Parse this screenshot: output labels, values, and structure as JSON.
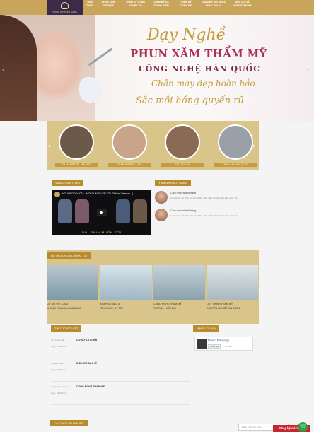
{
  "nav": {
    "logo_text": "THẨM MỸ VIỆN KARA",
    "items": [
      {
        "line1": "GIỚI",
        "line2": "THIỆU"
      },
      {
        "line1": "PHUN XĂM",
        "line2": "THẨM MỸ"
      },
      {
        "line1": "THẨM MỸ CÔNG",
        "line2": "NGHỆ CAO"
      },
      {
        "line1": "THẨM MỸ DA",
        "line2": "TRANG ĐIỂM"
      },
      {
        "line1": "THẨM MỸ",
        "line2": "THẨM MỸ"
      },
      {
        "line1": "THẨM MỸ NỘI KHOA",
        "line2": "PHẪU THUẬT"
      },
      {
        "line1": "ĐÀO TẠO VỀ",
        "line2": "NGHỀ THẨM MỸ"
      }
    ]
  },
  "hero": {
    "line1": "Dạy Nghề",
    "line2": "PHUN XĂM THẨM MỸ",
    "line3": "CÔNG NGHỆ HÀN QUỐC",
    "line4": "Chân mày đẹp hoàn hảo",
    "line5": "Sắc môi hồng quyến rũ"
  },
  "services": [
    {
      "label": "THẨM MỸ MẮT - MI MẮT",
      "color": "#6b5a4a"
    },
    {
      "label": "THẨM MỸ BIỂU - BỤI",
      "color": "#c8a48a"
    },
    {
      "label": "TRỊ LIỆU DA",
      "color": "#8a6a55"
    },
    {
      "label": "THẨM MỸ HÀN QUỐC",
      "color": "#9aa0a8"
    }
  ],
  "video": {
    "section_title": "VIDEO GIỚI THIỆU",
    "title": "HOUSROOM 2024 - MOI DUMOI LỆN TỚI [Official Vietnam...]",
    "banner": "NỘI SKIN MUỐN TỚI"
  },
  "reviews": {
    "section_title": "Ý KIẾN KHÁCH HÀNG",
    "items": [
      {
        "name": "Cảm nhận khách hàng",
        "text": "Lời cảm ơn gửi thẩm mỹ viện KARA, chúc thẩm mỹ viện phát triển mạnh mẽ"
      },
      {
        "name": "Cảm nhận khách hàng",
        "text": "Lời cảm ơn gửi thẩm mỹ viện KARA, chúc thẩm mỹ viện phát triển mạnh mẽ"
      }
    ]
  },
  "why": {
    "section_title": "TẠI SAO CHỌN CHÚNG TÔI",
    "items": [
      {
        "t1": "CƠ SỞ VẬT CHẤT",
        "t2": "KHANG TRANG, KHANG CAP"
      },
      {
        "t1": "ĐỘI NGŨ BÁC SĨ",
        "t2": "TAY NGHỀ, UY TÍN"
      },
      {
        "t1": "CÔNG NGHỆ THẨM MỸ",
        "t2": "TỐI TÂN, HIỆN ĐẠI"
      },
      {
        "t1": "QUY TRÌNH THẨM MỸ",
        "t2": "CHUYÊN NGHIỆP, AN TOÀN"
      }
    ]
  },
  "news": {
    "section_title": "TIN TỨC NỔI BẬT",
    "items": [
      {
        "thumb": "cơ sở vật chất",
        "title": "CƠ SỞ VẬT CHẤT",
        "date": "Ngày: 15-03-2016"
      },
      {
        "thumb": "đội ngũ bác sĩ",
        "title": "ĐỘI NGŨ BÁC SĨ",
        "date": "Ngày: 15-03-2016"
      },
      {
        "thumb": "công nghệ thẩm mỹ",
        "title": "CÔNG NGHỆ THẨM MỸ",
        "date": "Ngày: 15-03-2016"
      }
    ]
  },
  "social": {
    "section_title": "MẠNG XÃ HỘI",
    "page_name": "Demo Fanpage",
    "like_label": "Like Page",
    "followers": "59 likes"
  },
  "featured": {
    "section_title": "CÁC DỊCH VỤ NỔI BẬT"
  },
  "chat": {
    "placeholder": "Đăng ký tư vấn ngay",
    "signup_label": "Đăng ký miễn phí",
    "phone_icon": "phone-icon"
  }
}
